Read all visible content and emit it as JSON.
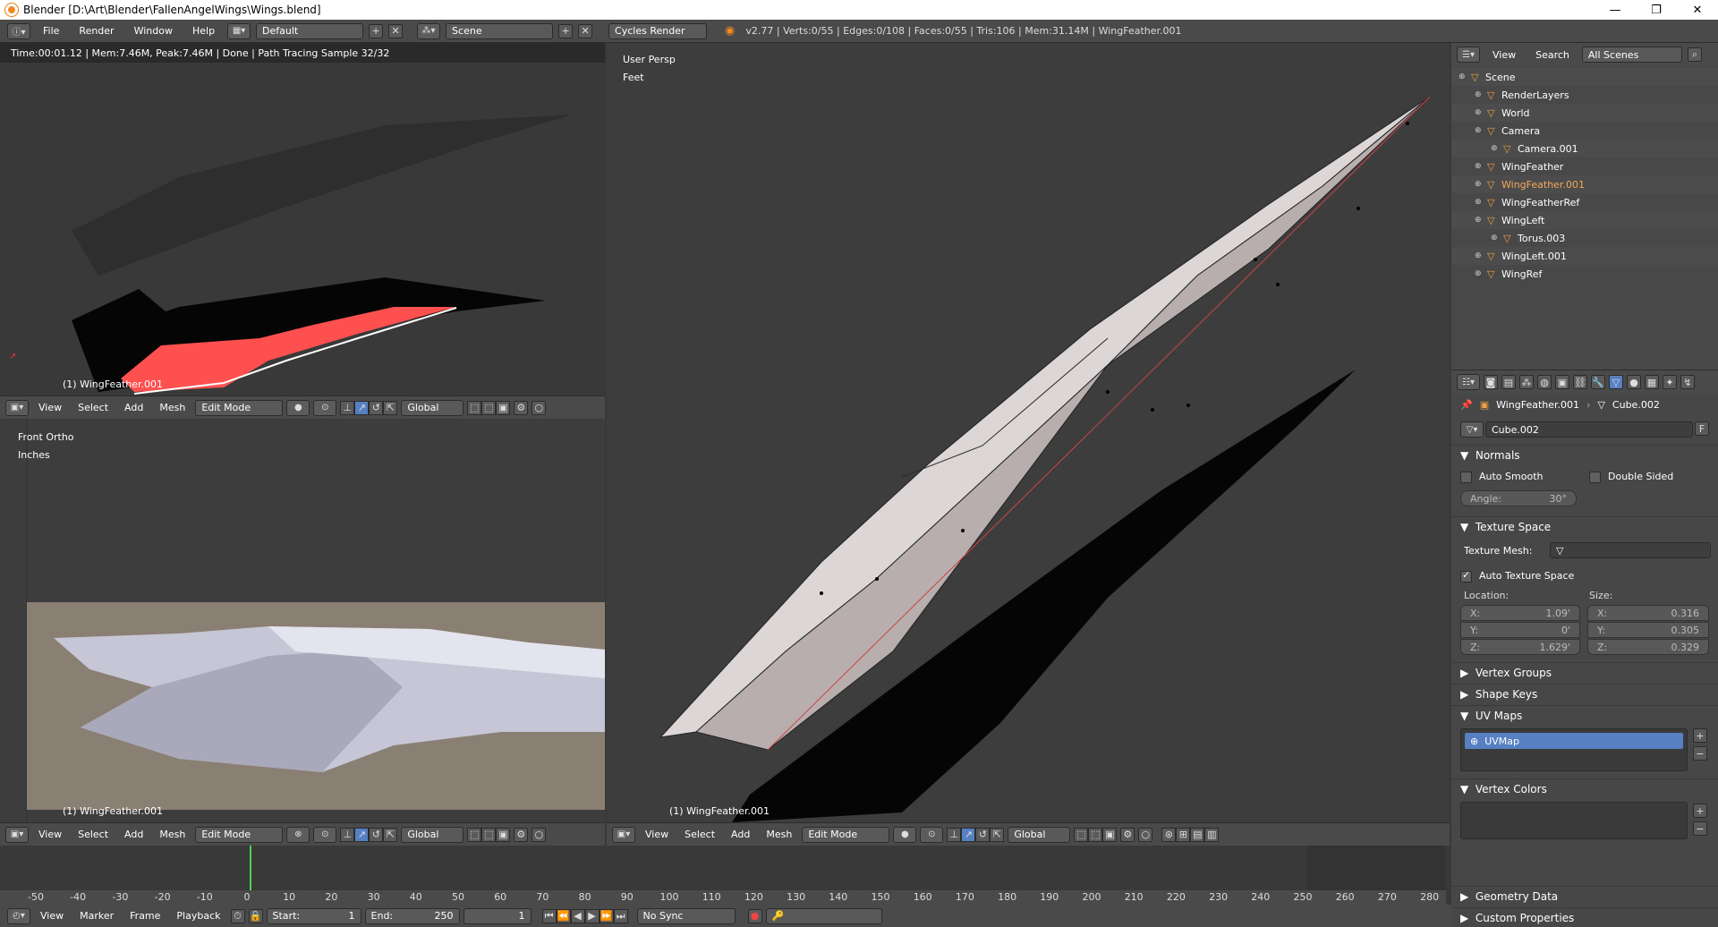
{
  "window": {
    "title": "Blender [D:\\Art\\Blender\\FallenAngelWings\\Wings.blend]"
  },
  "topbar": {
    "menus": [
      "File",
      "Render",
      "Window",
      "Help"
    ],
    "layout": "Default",
    "scene": "Scene",
    "engine": "Cycles Render",
    "stats": "v2.77 | Verts:0/55 | Edges:0/108 | Faces:0/55 | Tris:106 | Mem:31.14M | WingFeather.001"
  },
  "viewport_render": {
    "info": "Time:00:01.12 | Mem:7.46M, Peak:7.46M | Done | Path Tracing Sample 32/32",
    "object_label": "(1) WingFeather.001"
  },
  "viewport_front": {
    "view_name": "Front Ortho",
    "units": "Inches",
    "object_label": "(1) WingFeather.001"
  },
  "viewport_persp": {
    "view_name": "User Persp",
    "units": "Feet",
    "object_label": "(1) WingFeather.001"
  },
  "view_header": {
    "menus": [
      "View",
      "Select",
      "Add",
      "Mesh"
    ],
    "mode": "Edit Mode",
    "orientation": "Global"
  },
  "outliner": {
    "menus": [
      "View",
      "Search"
    ],
    "filter": "All Scenes",
    "items": [
      {
        "label": "Scene",
        "indent": 0
      },
      {
        "label": "RenderLayers",
        "indent": 1
      },
      {
        "label": "World",
        "indent": 1
      },
      {
        "label": "Camera",
        "indent": 1
      },
      {
        "label": "Camera.001",
        "indent": 2
      },
      {
        "label": "WingFeather",
        "indent": 1
      },
      {
        "label": "WingFeather.001",
        "indent": 1
      },
      {
        "label": "WingFeatherRef",
        "indent": 1
      },
      {
        "label": "WingLeft",
        "indent": 1
      },
      {
        "label": "Torus.003",
        "indent": 2
      },
      {
        "label": "WingLeft.001",
        "indent": 1
      },
      {
        "label": "WingRef",
        "indent": 1
      }
    ]
  },
  "properties": {
    "breadcrumb_object": "WingFeather.001",
    "breadcrumb_mesh": "Cube.002",
    "datablock": "Cube.002",
    "datablock_fake": "F",
    "normals": {
      "title": "Normals",
      "auto_smooth": "Auto Smooth",
      "double_sided": "Double Sided",
      "angle_label": "Angle:",
      "angle_value": "30°"
    },
    "texture_space": {
      "title": "Texture Space",
      "texture_mesh_label": "Texture Mesh:",
      "auto_texture_space": "Auto Texture Space",
      "location_label": "Location:",
      "size_label": "Size:",
      "loc": [
        {
          "axis": "X:",
          "value": "1.09'"
        },
        {
          "axis": "Y:",
          "value": "0'"
        },
        {
          "axis": "Z:",
          "value": "1.629'"
        }
      ],
      "size": [
        {
          "axis": "X:",
          "value": "0.316"
        },
        {
          "axis": "Y:",
          "value": "0.305"
        },
        {
          "axis": "Z:",
          "value": "0.329"
        }
      ]
    },
    "vertex_groups": "Vertex Groups",
    "shape_keys": "Shape Keys",
    "uv_maps": {
      "title": "UV Maps",
      "item": "UVMap"
    },
    "vertex_colors": "Vertex Colors",
    "geometry_data": "Geometry Data",
    "custom_properties": "Custom Properties"
  },
  "timeline": {
    "ticks": [
      "-50",
      "-40",
      "-30",
      "-20",
      "-10",
      "0",
      "10",
      "20",
      "30",
      "40",
      "50",
      "60",
      "70",
      "80",
      "90",
      "100",
      "110",
      "120",
      "130",
      "140",
      "150",
      "160",
      "170",
      "180",
      "190",
      "200",
      "210",
      "220",
      "230",
      "240",
      "250",
      "260",
      "270",
      "280"
    ],
    "menus": [
      "View",
      "Marker",
      "Frame",
      "Playback"
    ],
    "start_label": "Start:",
    "start": "1",
    "end_label": "End:",
    "end": "250",
    "current": "1",
    "sync": "No Sync"
  }
}
